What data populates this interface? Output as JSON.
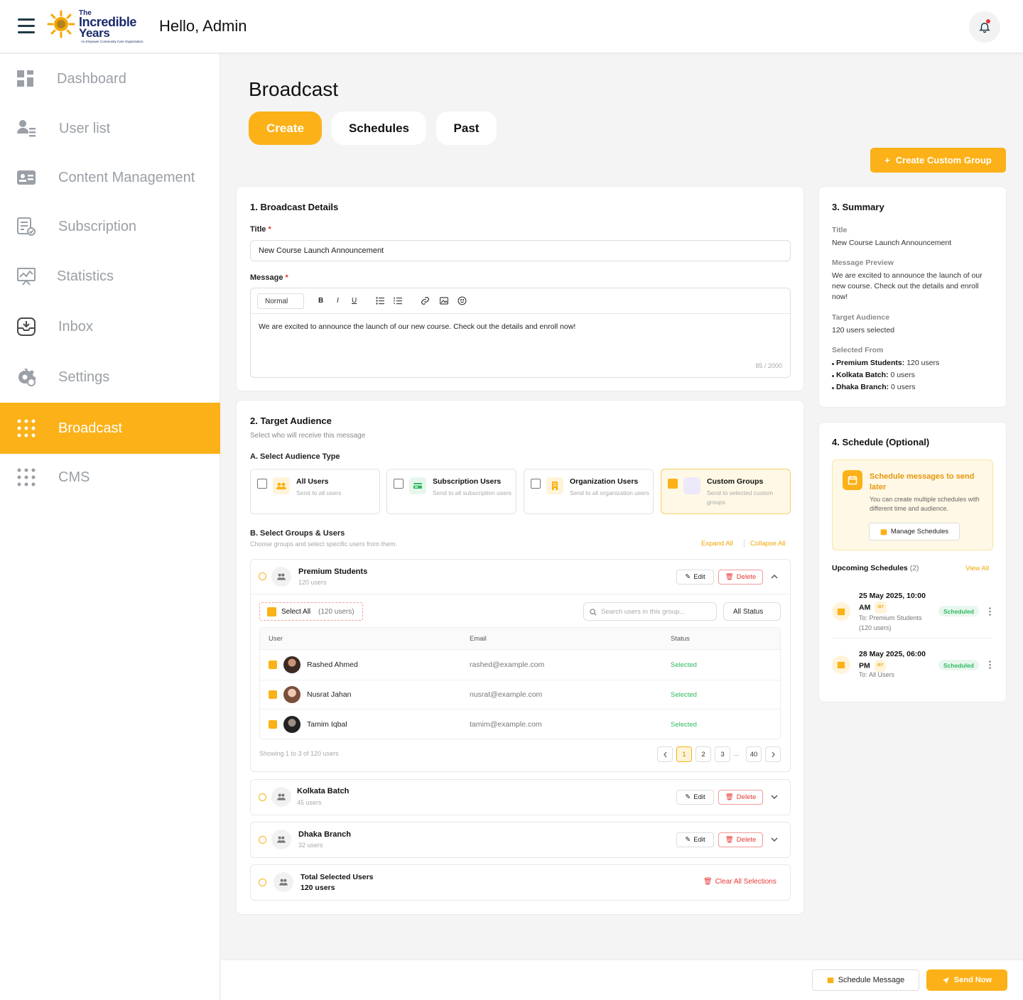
{
  "header": {
    "logo_line1": "The",
    "logo_line2": "Incredible",
    "logo_line3": "Years",
    "logo_tagline": "An Empower Community Care Organization",
    "greeting": "Hello, Admin"
  },
  "sidebar": {
    "items": [
      {
        "label": "Dashboard",
        "icon": "dashboard-icon"
      },
      {
        "label": "User list",
        "icon": "user-list-icon"
      },
      {
        "label": "Content Management",
        "icon": "content-card-icon"
      },
      {
        "label": "Subscription",
        "icon": "subscription-icon"
      },
      {
        "label": "Statistics",
        "icon": "statistics-icon"
      },
      {
        "label": "Inbox",
        "icon": "inbox-icon"
      },
      {
        "label": "Settings",
        "icon": "settings-icon"
      },
      {
        "label": "Broadcast",
        "icon": "grid-dots-icon",
        "active": true
      },
      {
        "label": "CMS",
        "icon": "grid-dots-icon"
      }
    ]
  },
  "page": {
    "title": "Broadcast",
    "tabs": [
      "Create",
      "Schedules",
      "Past"
    ],
    "create_group": "Create Custom Group"
  },
  "details": {
    "heading": "1. Broadcast Details",
    "title_label": "Title",
    "title_value": "New Course Launch Announcement",
    "message_label": "Message",
    "format": "Normal",
    "message_value": "We are excited to announce the launch of our new course. Check out the details and enroll now!",
    "char_count": "85 / 2000"
  },
  "audience": {
    "heading": "2. Target Audience",
    "subtitle": "Select who will receive this message",
    "type_label": "A. Select Audience Type",
    "types": [
      {
        "title": "All Users",
        "desc": "Send to all users"
      },
      {
        "title": "Subscription Users",
        "desc": "Send to all subscription users"
      },
      {
        "title": "Organization Users",
        "desc": "Send to all organization users"
      },
      {
        "title": "Custom Groups",
        "desc": "Send to selected custom groups"
      }
    ],
    "groups_label": "B. Select Groups & Users",
    "groups_sub": "Choose groups and select specific users from them.",
    "expand_all": "Expand All",
    "collapse_all": "Collapse All",
    "edit": "Edit",
    "delete": "Delete",
    "groups": [
      {
        "name": "Premium Students",
        "count": "120 users"
      },
      {
        "name": "Kolkata Batch",
        "count": "45 users"
      },
      {
        "name": "Dhaka Branch",
        "count": "32 users"
      }
    ],
    "select_all": "Select All",
    "select_all_count": "(120 users)",
    "search_placeholder": "Search users in this group...",
    "status_filter": "All Status",
    "table_headers": [
      "User",
      "Email",
      "Status"
    ],
    "users": [
      {
        "name": "Rashed Ahmed",
        "email": "rashed@example.com",
        "status": "Selected"
      },
      {
        "name": "Nusrat Jahan",
        "email": "nusrat@example.com",
        "status": "Selected"
      },
      {
        "name": "Tamim Iqbal",
        "email": "tamim@example.com",
        "status": "Selected"
      }
    ],
    "showing": "Showing 1 to 3 of 120 users",
    "pages": [
      "1",
      "2",
      "3",
      "...",
      "40"
    ],
    "total_label": "Total Selected Users",
    "total_value": "120 users",
    "clear_all": "Clear All Selections"
  },
  "summary": {
    "heading": "3. Summary",
    "title_label": "Title",
    "title_value": "New Course Launch Announcement",
    "preview_label": "Message Preview",
    "preview_value": "We are excited to announce the launch of our new course. Check out the details and enroll now!",
    "target_label": "Target Audience",
    "target_value": "120 users selected",
    "from_label": "Selected From",
    "from": [
      {
        "name": "Premium Students:",
        "count": "120 users"
      },
      {
        "name": "Kolkata Batch:",
        "count": "0 users"
      },
      {
        "name": "Dhaka Branch:",
        "count": "0 users"
      }
    ]
  },
  "schedule": {
    "heading": "4. Schedule (Optional)",
    "promo_title": "Schedule messages to send later",
    "promo_desc": "You can create multiple schedules with different time and audience.",
    "manage": "Manage Schedules",
    "upcoming": "Upcoming Schedules",
    "upcoming_count": "(2)",
    "view_all": "View All",
    "items": [
      {
        "date": "25 May 2025, 10:00 AM",
        "tz": "IST",
        "to": "To: Premium Students (120 users)",
        "status": "Scheduled"
      },
      {
        "date": "28 May 2025, 06:00 PM",
        "tz": "IST",
        "to": "To: All Users",
        "status": "Scheduled"
      }
    ]
  },
  "footer": {
    "schedule_btn": "Schedule Message",
    "send_btn": "Send Now"
  },
  "colors": {
    "accent": "#fbb117",
    "danger": "#e53935",
    "success": "#2eb85c"
  }
}
